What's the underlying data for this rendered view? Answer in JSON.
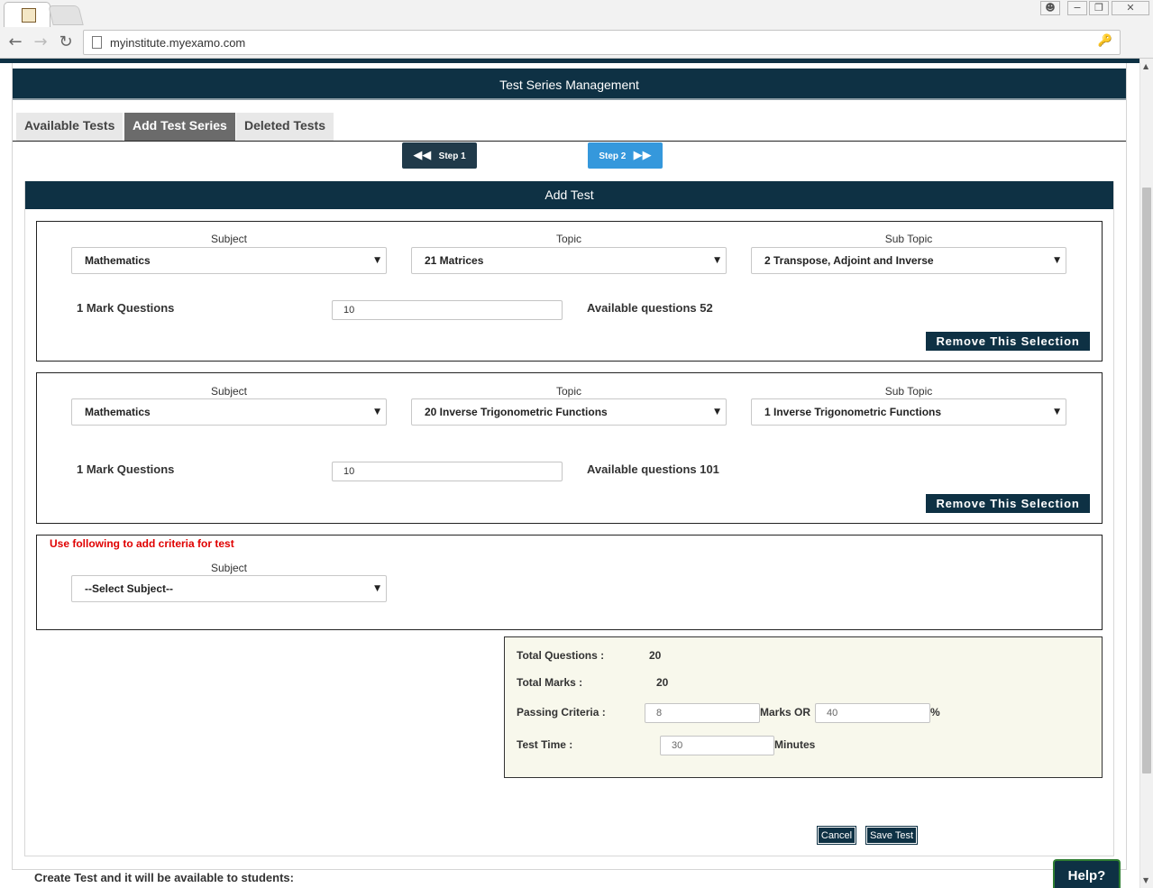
{
  "browser": {
    "url": "myinstitute.myexamo.com",
    "window_controls": [
      "−",
      "❐",
      "✕"
    ]
  },
  "page": {
    "header_title": "Test Series Management",
    "tabs": [
      {
        "label": "Available Tests",
        "active": false
      },
      {
        "label": "Add Test Series",
        "active": true
      },
      {
        "label": "Deleted Tests",
        "active": false
      }
    ],
    "steps": {
      "step1": "Step 1",
      "step2": "Step 2"
    },
    "add_test_title": "Add Test"
  },
  "criteria": [
    {
      "subject_label": "Subject",
      "subject": "Mathematics",
      "topic_label": "Topic",
      "topic": "21 Matrices",
      "subtopic_label": "Sub Topic",
      "subtopic": "2 Transpose, Adjoint and Inverse",
      "questions_label": "1 Mark Questions",
      "questions_value": "10",
      "available": "Available questions 52",
      "remove_label": "Remove This Selection"
    },
    {
      "subject_label": "Subject",
      "subject": "Mathematics",
      "topic_label": "Topic",
      "topic": "20 Inverse Trigonometric Functions",
      "subtopic_label": "Sub Topic",
      "subtopic": "1 Inverse Trigonometric Functions",
      "questions_label": "1 Mark Questions",
      "questions_value": "10",
      "available": "Available questions 101",
      "remove_label": "Remove This Selection"
    }
  ],
  "new_criteria": {
    "hint": "Use following to add criteria for test",
    "subject_label": "Subject",
    "subject_placeholder": "--Select Subject--"
  },
  "summary": {
    "total_questions_label": "Total Questions :",
    "total_questions": "20",
    "total_marks_label": "Total Marks :",
    "total_marks": "20",
    "passing_label": "Passing Criteria :",
    "passing_marks": "8",
    "marks_or_label": "Marks OR",
    "passing_percent": "40",
    "percent_sign": "%",
    "time_label": "Test Time :",
    "time_value": "30",
    "minutes_label": "Minutes"
  },
  "actions": {
    "cancel": "Cancel",
    "save": "Save Test"
  },
  "footer_text": "Create Test and it will be available to students:",
  "help_label": "Help?",
  "colors": {
    "brand_dark": "#0e3144",
    "step_blue": "#3598dc",
    "hint_red": "#e00000"
  }
}
